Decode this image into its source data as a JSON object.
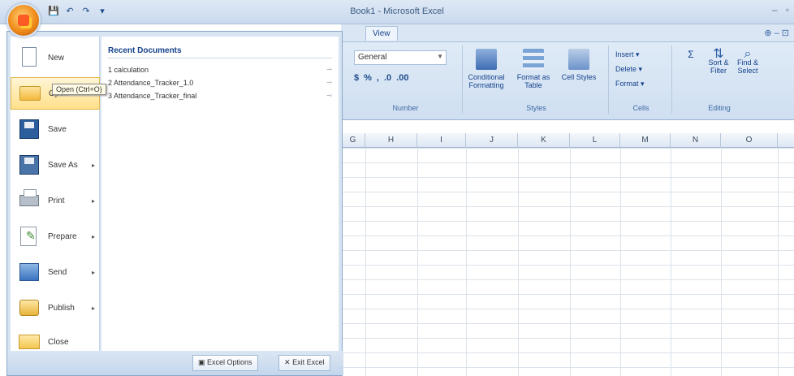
{
  "window": {
    "title": "Book1 - Microsoft Excel",
    "controls": [
      "–",
      "▫"
    ]
  },
  "qat": {
    "icons": [
      "save-icon",
      "undo-icon",
      "redo-icon",
      "customize-icon"
    ],
    "glyphs": [
      "💾",
      "↶",
      "↷",
      "▾"
    ]
  },
  "ribbon": {
    "active_tab": "View",
    "help_glyphs": "⊕ – ⊡",
    "number": {
      "format_value": "General",
      "buttons": [
        "$",
        "%",
        ",",
        ".0",
        ".00"
      ],
      "label": "Number"
    },
    "styles": {
      "label": "Styles",
      "conditional": "Conditional Formatting",
      "format_table": "Format as Table",
      "cell_styles": "Cell Styles"
    },
    "cells": {
      "label": "Cells",
      "insert": "Insert",
      "delete": "Delete",
      "format": "Format"
    },
    "editing": {
      "label": "Editing",
      "sort_filter": "Sort & Filter",
      "find_select": "Find & Select"
    }
  },
  "grid": {
    "columns": [
      "G",
      "H",
      "I",
      "J",
      "K",
      "L",
      "M",
      "N",
      "O"
    ]
  },
  "office_menu": {
    "items": [
      {
        "label": "New",
        "icon": "new-document-icon"
      },
      {
        "label": "Open",
        "icon": "open-folder-icon"
      },
      {
        "label": "Save",
        "icon": "save-disk-icon"
      },
      {
        "label": "Save As",
        "icon": "save-as-icon"
      },
      {
        "label": "Print",
        "icon": "printer-icon"
      },
      {
        "label": "Prepare",
        "icon": "prepare-icon"
      },
      {
        "label": "Send",
        "icon": "send-icon"
      },
      {
        "label": "Publish",
        "icon": "publish-icon"
      },
      {
        "label": "Close",
        "icon": "close-folder-icon"
      }
    ],
    "arrow_glyph": "▸",
    "tooltip": "Open (Ctrl+O)",
    "recent_title": "Recent Documents",
    "recent": [
      "1  calculation",
      "2  Attendance_Tracker_1.0",
      "3  Attendance_Tracker_final"
    ],
    "pin_glyph": "⊸",
    "excel_options": "Excel Options",
    "exit_excel": "Exit Excel"
  }
}
